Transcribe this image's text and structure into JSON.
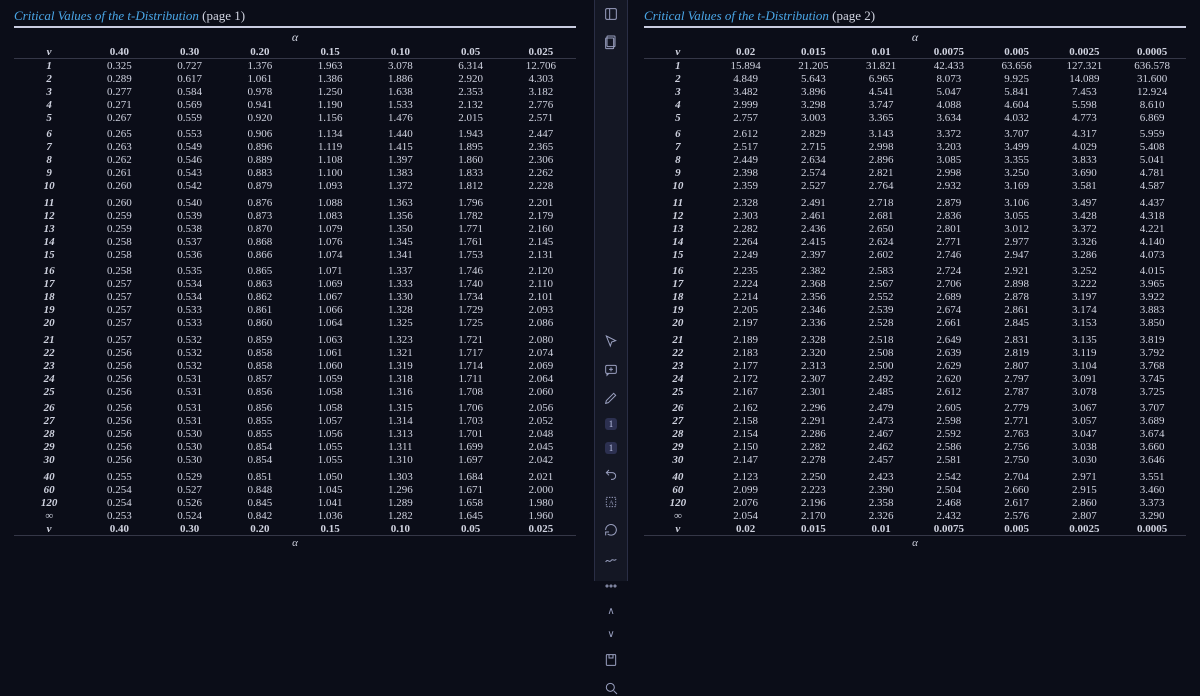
{
  "page1": {
    "title_prefix": "Critical Values of the ",
    "title_ital": "t",
    "title_suffix": "-Distribution",
    "page_label": "(page 1)",
    "alpha_symbol": "α",
    "df_symbol": "v",
    "headers": [
      "0.40",
      "0.30",
      "0.20",
      "0.15",
      "0.10",
      "0.05",
      "0.025"
    ],
    "rows": [
      {
        "df": "1",
        "v": [
          "0.325",
          "0.727",
          "1.376",
          "1.963",
          "3.078",
          "6.314",
          "12.706"
        ]
      },
      {
        "df": "2",
        "v": [
          "0.289",
          "0.617",
          "1.061",
          "1.386",
          "1.886",
          "2.920",
          "4.303"
        ]
      },
      {
        "df": "3",
        "v": [
          "0.277",
          "0.584",
          "0.978",
          "1.250",
          "1.638",
          "2.353",
          "3.182"
        ]
      },
      {
        "df": "4",
        "v": [
          "0.271",
          "0.569",
          "0.941",
          "1.190",
          "1.533",
          "2.132",
          "2.776"
        ]
      },
      {
        "df": "5",
        "v": [
          "0.267",
          "0.559",
          "0.920",
          "1.156",
          "1.476",
          "2.015",
          "2.571"
        ]
      },
      {
        "df": "6",
        "v": [
          "0.265",
          "0.553",
          "0.906",
          "1.134",
          "1.440",
          "1.943",
          "2.447"
        ]
      },
      {
        "df": "7",
        "v": [
          "0.263",
          "0.549",
          "0.896",
          "1.119",
          "1.415",
          "1.895",
          "2.365"
        ]
      },
      {
        "df": "8",
        "v": [
          "0.262",
          "0.546",
          "0.889",
          "1.108",
          "1.397",
          "1.860",
          "2.306"
        ]
      },
      {
        "df": "9",
        "v": [
          "0.261",
          "0.543",
          "0.883",
          "1.100",
          "1.383",
          "1.833",
          "2.262"
        ]
      },
      {
        "df": "10",
        "v": [
          "0.260",
          "0.542",
          "0.879",
          "1.093",
          "1.372",
          "1.812",
          "2.228"
        ]
      },
      {
        "df": "11",
        "v": [
          "0.260",
          "0.540",
          "0.876",
          "1.088",
          "1.363",
          "1.796",
          "2.201"
        ]
      },
      {
        "df": "12",
        "v": [
          "0.259",
          "0.539",
          "0.873",
          "1.083",
          "1.356",
          "1.782",
          "2.179"
        ]
      },
      {
        "df": "13",
        "v": [
          "0.259",
          "0.538",
          "0.870",
          "1.079",
          "1.350",
          "1.771",
          "2.160"
        ]
      },
      {
        "df": "14",
        "v": [
          "0.258",
          "0.537",
          "0.868",
          "1.076",
          "1.345",
          "1.761",
          "2.145"
        ]
      },
      {
        "df": "15",
        "v": [
          "0.258",
          "0.536",
          "0.866",
          "1.074",
          "1.341",
          "1.753",
          "2.131"
        ]
      },
      {
        "df": "16",
        "v": [
          "0.258",
          "0.535",
          "0.865",
          "1.071",
          "1.337",
          "1.746",
          "2.120"
        ]
      },
      {
        "df": "17",
        "v": [
          "0.257",
          "0.534",
          "0.863",
          "1.069",
          "1.333",
          "1.740",
          "2.110"
        ]
      },
      {
        "df": "18",
        "v": [
          "0.257",
          "0.534",
          "0.862",
          "1.067",
          "1.330",
          "1.734",
          "2.101"
        ]
      },
      {
        "df": "19",
        "v": [
          "0.257",
          "0.533",
          "0.861",
          "1.066",
          "1.328",
          "1.729",
          "2.093"
        ]
      },
      {
        "df": "20",
        "v": [
          "0.257",
          "0.533",
          "0.860",
          "1.064",
          "1.325",
          "1.725",
          "2.086"
        ]
      },
      {
        "df": "21",
        "v": [
          "0.257",
          "0.532",
          "0.859",
          "1.063",
          "1.323",
          "1.721",
          "2.080"
        ]
      },
      {
        "df": "22",
        "v": [
          "0.256",
          "0.532",
          "0.858",
          "1.061",
          "1.321",
          "1.717",
          "2.074"
        ]
      },
      {
        "df": "23",
        "v": [
          "0.256",
          "0.532",
          "0.858",
          "1.060",
          "1.319",
          "1.714",
          "2.069"
        ]
      },
      {
        "df": "24",
        "v": [
          "0.256",
          "0.531",
          "0.857",
          "1.059",
          "1.318",
          "1.711",
          "2.064"
        ]
      },
      {
        "df": "25",
        "v": [
          "0.256",
          "0.531",
          "0.856",
          "1.058",
          "1.316",
          "1.708",
          "2.060"
        ]
      },
      {
        "df": "26",
        "v": [
          "0.256",
          "0.531",
          "0.856",
          "1.058",
          "1.315",
          "1.706",
          "2.056"
        ]
      },
      {
        "df": "27",
        "v": [
          "0.256",
          "0.531",
          "0.855",
          "1.057",
          "1.314",
          "1.703",
          "2.052"
        ]
      },
      {
        "df": "28",
        "v": [
          "0.256",
          "0.530",
          "0.855",
          "1.056",
          "1.313",
          "1.701",
          "2.048"
        ]
      },
      {
        "df": "29",
        "v": [
          "0.256",
          "0.530",
          "0.854",
          "1.055",
          "1.311",
          "1.699",
          "2.045"
        ]
      },
      {
        "df": "30",
        "v": [
          "0.256",
          "0.530",
          "0.854",
          "1.055",
          "1.310",
          "1.697",
          "2.042"
        ]
      },
      {
        "df": "40",
        "v": [
          "0.255",
          "0.529",
          "0.851",
          "1.050",
          "1.303",
          "1.684",
          "2.021"
        ]
      },
      {
        "df": "60",
        "v": [
          "0.254",
          "0.527",
          "0.848",
          "1.045",
          "1.296",
          "1.671",
          "2.000"
        ]
      },
      {
        "df": "120",
        "v": [
          "0.254",
          "0.526",
          "0.845",
          "1.041",
          "1.289",
          "1.658",
          "1.980"
        ]
      },
      {
        "df": "∞",
        "v": [
          "0.253",
          "0.524",
          "0.842",
          "1.036",
          "1.282",
          "1.645",
          "1.960"
        ]
      }
    ]
  },
  "page2": {
    "title_prefix": "Critical Values of the ",
    "title_ital": "t",
    "title_suffix": "-Distribution",
    "page_label": "(page 2)",
    "alpha_symbol": "α",
    "df_symbol": "v",
    "headers": [
      "0.02",
      "0.015",
      "0.01",
      "0.0075",
      "0.005",
      "0.0025",
      "0.0005"
    ],
    "rows": [
      {
        "df": "1",
        "v": [
          "15.894",
          "21.205",
          "31.821",
          "42.433",
          "63.656",
          "127.321",
          "636.578"
        ]
      },
      {
        "df": "2",
        "v": [
          "4.849",
          "5.643",
          "6.965",
          "8.073",
          "9.925",
          "14.089",
          "31.600"
        ]
      },
      {
        "df": "3",
        "v": [
          "3.482",
          "3.896",
          "4.541",
          "5.047",
          "5.841",
          "7.453",
          "12.924"
        ]
      },
      {
        "df": "4",
        "v": [
          "2.999",
          "3.298",
          "3.747",
          "4.088",
          "4.604",
          "5.598",
          "8.610"
        ]
      },
      {
        "df": "5",
        "v": [
          "2.757",
          "3.003",
          "3.365",
          "3.634",
          "4.032",
          "4.773",
          "6.869"
        ]
      },
      {
        "df": "6",
        "v": [
          "2.612",
          "2.829",
          "3.143",
          "3.372",
          "3.707",
          "4.317",
          "5.959"
        ]
      },
      {
        "df": "7",
        "v": [
          "2.517",
          "2.715",
          "2.998",
          "3.203",
          "3.499",
          "4.029",
          "5.408"
        ]
      },
      {
        "df": "8",
        "v": [
          "2.449",
          "2.634",
          "2.896",
          "3.085",
          "3.355",
          "3.833",
          "5.041"
        ]
      },
      {
        "df": "9",
        "v": [
          "2.398",
          "2.574",
          "2.821",
          "2.998",
          "3.250",
          "3.690",
          "4.781"
        ]
      },
      {
        "df": "10",
        "v": [
          "2.359",
          "2.527",
          "2.764",
          "2.932",
          "3.169",
          "3.581",
          "4.587"
        ]
      },
      {
        "df": "11",
        "v": [
          "2.328",
          "2.491",
          "2.718",
          "2.879",
          "3.106",
          "3.497",
          "4.437"
        ]
      },
      {
        "df": "12",
        "v": [
          "2.303",
          "2.461",
          "2.681",
          "2.836",
          "3.055",
          "3.428",
          "4.318"
        ]
      },
      {
        "df": "13",
        "v": [
          "2.282",
          "2.436",
          "2.650",
          "2.801",
          "3.012",
          "3.372",
          "4.221"
        ]
      },
      {
        "df": "14",
        "v": [
          "2.264",
          "2.415",
          "2.624",
          "2.771",
          "2.977",
          "3.326",
          "4.140"
        ]
      },
      {
        "df": "15",
        "v": [
          "2.249",
          "2.397",
          "2.602",
          "2.746",
          "2.947",
          "3.286",
          "4.073"
        ]
      },
      {
        "df": "16",
        "v": [
          "2.235",
          "2.382",
          "2.583",
          "2.724",
          "2.921",
          "3.252",
          "4.015"
        ]
      },
      {
        "df": "17",
        "v": [
          "2.224",
          "2.368",
          "2.567",
          "2.706",
          "2.898",
          "3.222",
          "3.965"
        ]
      },
      {
        "df": "18",
        "v": [
          "2.214",
          "2.356",
          "2.552",
          "2.689",
          "2.878",
          "3.197",
          "3.922"
        ]
      },
      {
        "df": "19",
        "v": [
          "2.205",
          "2.346",
          "2.539",
          "2.674",
          "2.861",
          "3.174",
          "3.883"
        ]
      },
      {
        "df": "20",
        "v": [
          "2.197",
          "2.336",
          "2.528",
          "2.661",
          "2.845",
          "3.153",
          "3.850"
        ]
      },
      {
        "df": "21",
        "v": [
          "2.189",
          "2.328",
          "2.518",
          "2.649",
          "2.831",
          "3.135",
          "3.819"
        ]
      },
      {
        "df": "22",
        "v": [
          "2.183",
          "2.320",
          "2.508",
          "2.639",
          "2.819",
          "3.119",
          "3.792"
        ]
      },
      {
        "df": "23",
        "v": [
          "2.177",
          "2.313",
          "2.500",
          "2.629",
          "2.807",
          "3.104",
          "3.768"
        ]
      },
      {
        "df": "24",
        "v": [
          "2.172",
          "2.307",
          "2.492",
          "2.620",
          "2.797",
          "3.091",
          "3.745"
        ]
      },
      {
        "df": "25",
        "v": [
          "2.167",
          "2.301",
          "2.485",
          "2.612",
          "2.787",
          "3.078",
          "3.725"
        ]
      },
      {
        "df": "26",
        "v": [
          "2.162",
          "2.296",
          "2.479",
          "2.605",
          "2.779",
          "3.067",
          "3.707"
        ]
      },
      {
        "df": "27",
        "v": [
          "2.158",
          "2.291",
          "2.473",
          "2.598",
          "2.771",
          "3.057",
          "3.689"
        ]
      },
      {
        "df": "28",
        "v": [
          "2.154",
          "2.286",
          "2.467",
          "2.592",
          "2.763",
          "3.047",
          "3.674"
        ]
      },
      {
        "df": "29",
        "v": [
          "2.150",
          "2.282",
          "2.462",
          "2.586",
          "2.756",
          "3.038",
          "3.660"
        ]
      },
      {
        "df": "30",
        "v": [
          "2.147",
          "2.278",
          "2.457",
          "2.581",
          "2.750",
          "3.030",
          "3.646"
        ]
      },
      {
        "df": "40",
        "v": [
          "2.123",
          "2.250",
          "2.423",
          "2.542",
          "2.704",
          "2.971",
          "3.551"
        ]
      },
      {
        "df": "60",
        "v": [
          "2.099",
          "2.223",
          "2.390",
          "2.504",
          "2.660",
          "2.915",
          "3.460"
        ]
      },
      {
        "df": "120",
        "v": [
          "2.076",
          "2.196",
          "2.358",
          "2.468",
          "2.617",
          "2.860",
          "3.373"
        ]
      },
      {
        "df": "∞",
        "v": [
          "2.054",
          "2.170",
          "2.326",
          "2.432",
          "2.576",
          "2.807",
          "3.290"
        ]
      }
    ]
  },
  "toolbar": {
    "page_badge_1": "1",
    "page_badge_2": "1"
  }
}
